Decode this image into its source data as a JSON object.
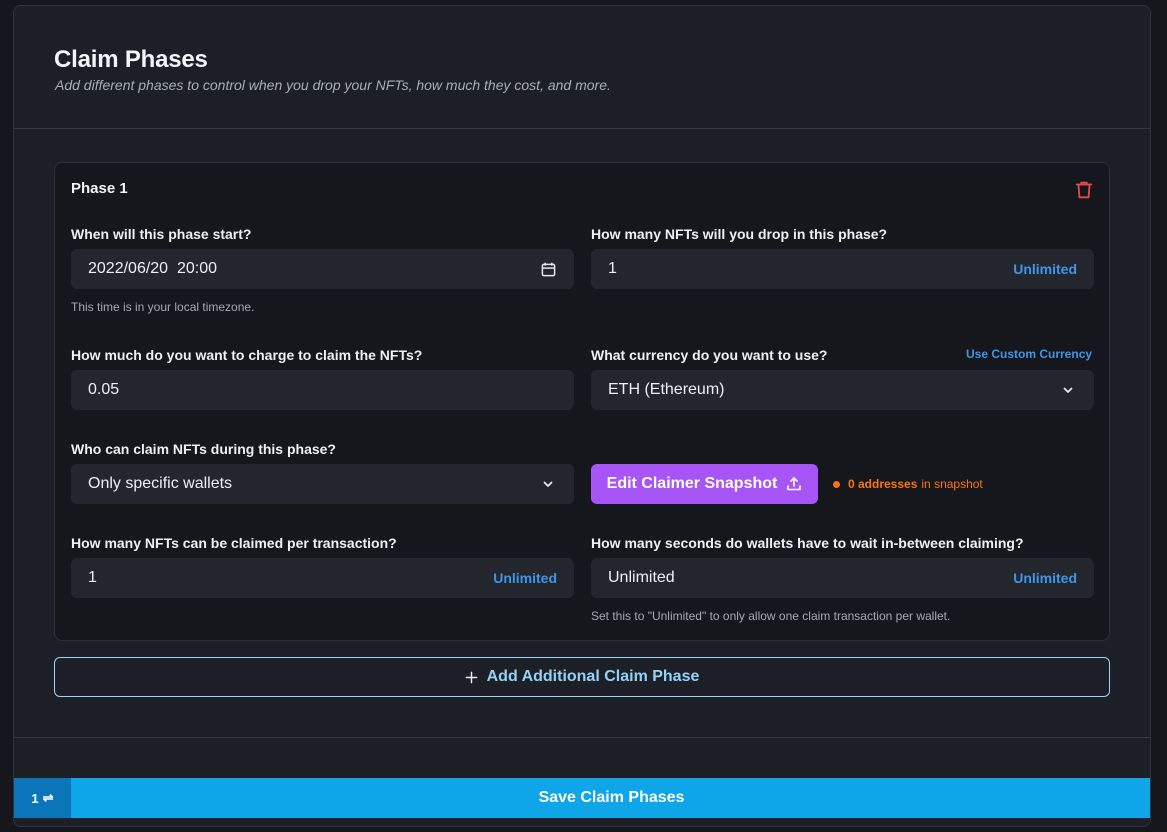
{
  "header": {
    "title": "Claim Phases",
    "subtitle": "Add different phases to control when you drop your NFTs, how much they cost, and more."
  },
  "phase": {
    "title": "Phase 1",
    "start": {
      "label": "When will this phase start?",
      "value": "2022/06/20  20:00",
      "help": "This time is in your local timezone."
    },
    "drop_count": {
      "label": "How many NFTs will you drop in this phase?",
      "value": "1",
      "unlimited_label": "Unlimited"
    },
    "price": {
      "label": "How much do you want to charge to claim the NFTs?",
      "value": "0.05"
    },
    "currency": {
      "label": "What currency do you want to use?",
      "custom_link": "Use Custom Currency",
      "selected": "ETH (Ethereum)"
    },
    "claimers": {
      "label": "Who can claim NFTs during this phase?",
      "selected": "Only specific wallets",
      "snapshot_button": "Edit Claimer Snapshot",
      "snapshot_count": "0 addresses",
      "snapshot_suffix": "in snapshot"
    },
    "per_tx": {
      "label": "How many NFTs can be claimed per transaction?",
      "value": "1",
      "unlimited_label": "Unlimited"
    },
    "wait": {
      "label": "How many seconds do wallets have to wait in-between claiming?",
      "value": "Unlimited",
      "unlimited_label": "Unlimited",
      "help": "Set this to \"Unlimited\" to only allow one claim transaction per wallet."
    }
  },
  "add_phase_label": "Add Additional Claim Phase",
  "footer": {
    "counter": "1",
    "save_label": "Save Claim Phases"
  },
  "colors": {
    "accent": "#0ea5e9",
    "snapshot_button": "#a855f7",
    "warning": "#f97316",
    "link": "#3f95e8",
    "danger": "#e5484d"
  }
}
